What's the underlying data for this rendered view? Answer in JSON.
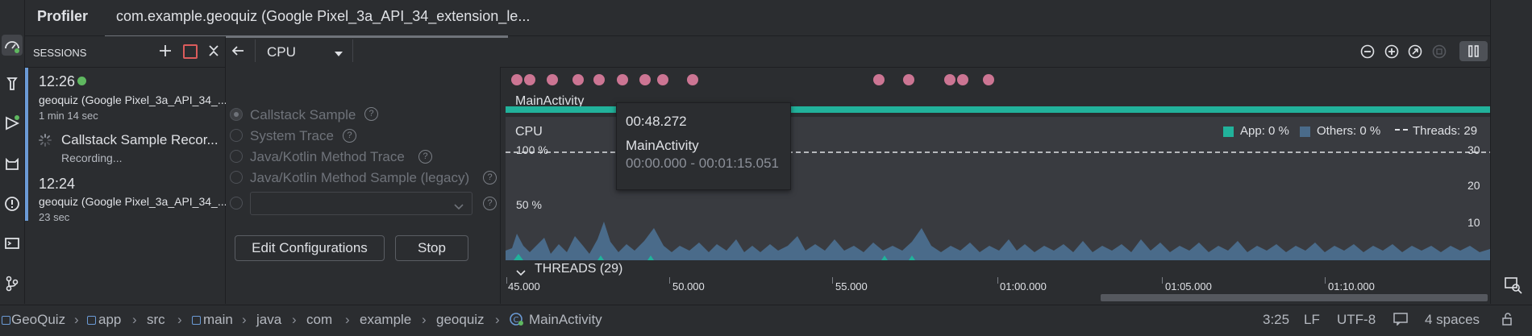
{
  "header": {
    "title": "Profiler",
    "tab_label": "com.example.geoquiz (Google Pixel_3a_API_34_extension_le..."
  },
  "sessions": {
    "heading": "SESSIONS",
    "items": [
      {
        "time": "12:26",
        "device": "geoquiz (Google Pixel_3a_API_34_...",
        "duration": "1 min 14 sec",
        "active": true
      },
      {
        "time": "12:24",
        "device": "geoquiz (Google Pixel_3a_API_34_...",
        "duration": "23 sec",
        "active": false
      }
    ],
    "recording": {
      "title": "Callstack Sample Recor...",
      "status": "Recording..."
    }
  },
  "toolbar": {
    "profiler_select": "CPU"
  },
  "config": {
    "options": [
      "Callstack Sample",
      "System Trace",
      "Java/Kotlin Method Trace",
      "Java/Kotlin Method Sample (legacy)"
    ],
    "edit_button": "Edit Configurations",
    "stop_button": "Stop"
  },
  "chart": {
    "activity_label": "MainActivity",
    "cpu_label": "CPU",
    "y_labels": [
      "100 %",
      "50 %"
    ],
    "right_y_labels": [
      "30",
      "20",
      "10"
    ],
    "legend": {
      "app": "App: 0 %",
      "others": "Others: 0 %",
      "threads": "Threads: 29"
    },
    "threads_label": "THREADS (29)",
    "time_ticks": [
      "45.000",
      "50.000",
      "55.000",
      "01:00.000",
      "01:05.000",
      "01:10.000"
    ]
  },
  "tooltip": {
    "time": "00:48.272",
    "activity": "MainActivity",
    "range": "00:00.000 - 00:01:15.051"
  },
  "breadcrumb": [
    "GeoQuiz",
    "app",
    "src",
    "main",
    "java",
    "com",
    "example",
    "geoquiz",
    "MainActivity"
  ],
  "status": {
    "position": "3:25",
    "line_ending": "LF",
    "encoding": "UTF-8",
    "indent": "4 spaces"
  },
  "colors": {
    "accent_teal": "#21b29b",
    "event_pink": "#cc7593",
    "others_blue": "#4a6b8a",
    "green": "#5fb860"
  }
}
